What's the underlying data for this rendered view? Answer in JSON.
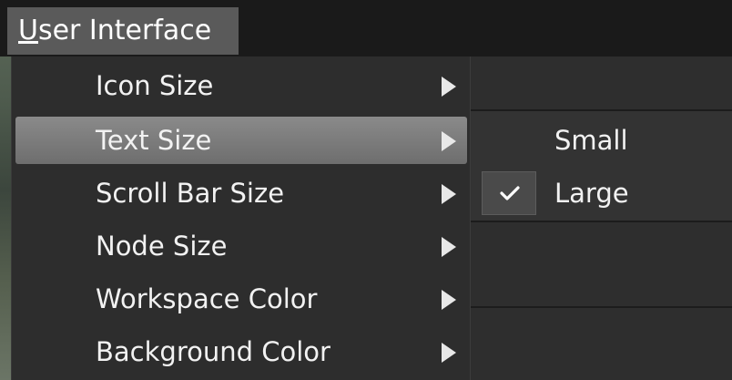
{
  "menubar": {
    "title_mnemonic": "U",
    "title_rest": "ser Interface"
  },
  "menu": {
    "items": [
      {
        "label": "Icon Size",
        "icon": "chevron-right-icon",
        "active": false
      },
      {
        "label": "Text Size",
        "icon": "chevron-right-icon",
        "active": true
      },
      {
        "label": "Scroll Bar Size",
        "icon": "chevron-right-icon",
        "active": false
      },
      {
        "label": "Node Size",
        "icon": "chevron-right-icon",
        "active": false
      },
      {
        "label": "Workspace Color",
        "icon": "chevron-right-icon",
        "active": false
      },
      {
        "label": "Background Color",
        "icon": "chevron-right-icon",
        "active": false
      }
    ]
  },
  "submenu": {
    "items": [
      {
        "label": "Small",
        "checked": false
      },
      {
        "label": "Large",
        "checked": true,
        "icon": "checkmark-icon"
      }
    ]
  },
  "colors": {
    "menubar_bg": "#1a1a1a",
    "menubar_title_bg": "#5a5a5a",
    "menu_bg": "#2d2d2d",
    "menu_active_bg": "#7c7c7c",
    "submenu_bg": "#333333",
    "text": "#f2f2f2"
  }
}
